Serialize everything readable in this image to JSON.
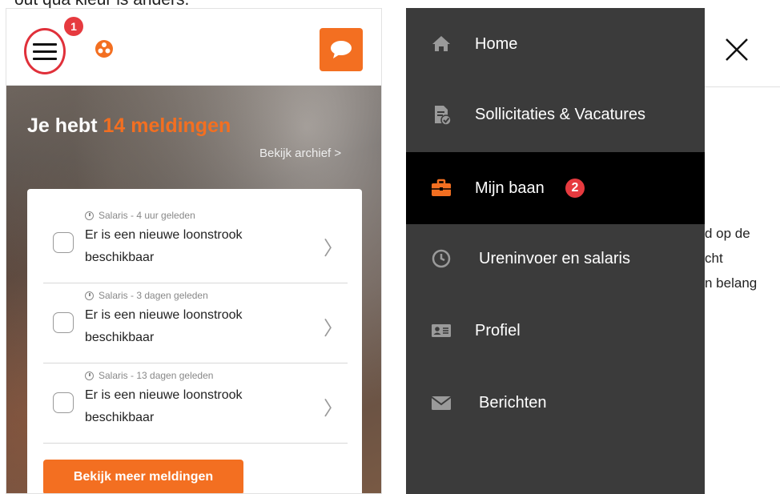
{
  "caption": "out qua kleur is anders.",
  "left": {
    "header": {
      "hamburger_badge": "1",
      "brand_color": "#f36f21"
    },
    "hero": {
      "title_prefix": "Je hebt",
      "title_count": "14 meldingen",
      "archive_link": "Bekijk archief >"
    },
    "notifications": [
      {
        "meta": "Salaris - 4 uur geleden",
        "text": "Er is een nieuwe loonstrook beschikbaar"
      },
      {
        "meta": "Salaris - 3 dagen geleden",
        "text": "Er is een nieuwe loonstrook beschikbaar"
      },
      {
        "meta": "Salaris - 13 dagen geleden",
        "text": "Er is een nieuwe loonstrook beschikbaar"
      }
    ],
    "more_button": "Bekijk meer meldingen"
  },
  "right": {
    "menu": [
      {
        "label": "Home",
        "icon": "home-icon",
        "active": false
      },
      {
        "label": "Sollicitaties & Vacatures",
        "icon": "document-check-icon",
        "active": false
      },
      {
        "label": "Mijn baan",
        "icon": "briefcase-icon",
        "active": true,
        "badge": "2"
      },
      {
        "label": "Ureninvoer en salaris",
        "icon": "clock-icon",
        "active": false
      },
      {
        "label": "Profiel",
        "icon": "id-card-icon",
        "active": false
      },
      {
        "label": "Berichten",
        "icon": "envelope-icon",
        "active": false
      }
    ],
    "behind_text": [
      "d op de",
      "cht",
      "n belang"
    ]
  },
  "colors": {
    "accent": "#f36f21",
    "badge": "#e63a3f",
    "menu_bg": "#3b3b3b",
    "menu_active_bg": "#000000"
  }
}
